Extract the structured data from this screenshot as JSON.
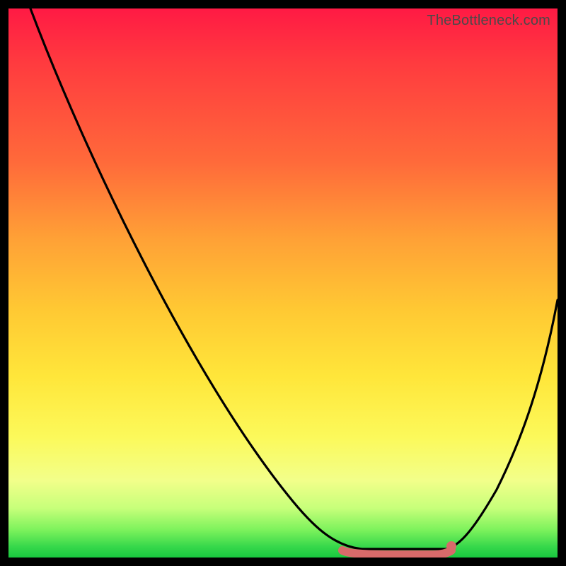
{
  "watermark": {
    "text": "TheBottleneck.com"
  },
  "chart_data": {
    "type": "line",
    "title": "",
    "xlabel": "",
    "ylabel": "",
    "ylim": [
      0,
      100
    ],
    "xlim": [
      0,
      100
    ],
    "series": [
      {
        "name": "curve",
        "x": [
          4,
          10,
          20,
          30,
          40,
          50,
          56,
          60,
          64,
          68,
          72,
          76,
          80,
          84,
          90,
          96,
          100
        ],
        "y": [
          100,
          90,
          74,
          58,
          42,
          26,
          14,
          8,
          3,
          0,
          0,
          0,
          3,
          8,
          20,
          36,
          48
        ]
      }
    ],
    "flat_region": {
      "x_start": 62,
      "x_end": 80,
      "color": "#d86a6a"
    },
    "endpoint_dot": {
      "x": 80,
      "y": 2,
      "color": "#d86a6a"
    },
    "background_gradient": {
      "stops": [
        {
          "pos": 0.0,
          "color": "#ff1a44"
        },
        {
          "pos": 0.5,
          "color": "#ffc933"
        },
        {
          "pos": 0.8,
          "color": "#f8ff7a"
        },
        {
          "pos": 1.0,
          "color": "#18c73f"
        }
      ]
    }
  }
}
